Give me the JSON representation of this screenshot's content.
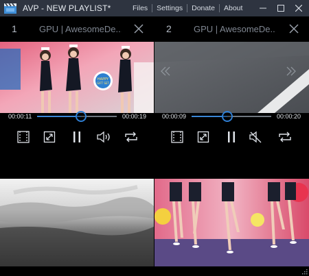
{
  "window": {
    "title": "AVP - NEW PLAYLIST*",
    "menu": [
      "Files",
      "Settings",
      "Donate",
      "About"
    ]
  },
  "panes": [
    {
      "index": "1",
      "title": "GPU | AwesomeDe...",
      "current_time": "00:00:11",
      "total_time": "00:00:19",
      "progress": 0.55,
      "muted": false
    },
    {
      "index": "2",
      "title": "GPU | AwesomeDe...",
      "current_time": "00:00:09",
      "total_time": "00:00:20",
      "progress": 0.45,
      "muted": true
    }
  ],
  "colors": {
    "titlebar": "#2e3440",
    "accent": "#2f7fd4",
    "background": "#000000"
  }
}
